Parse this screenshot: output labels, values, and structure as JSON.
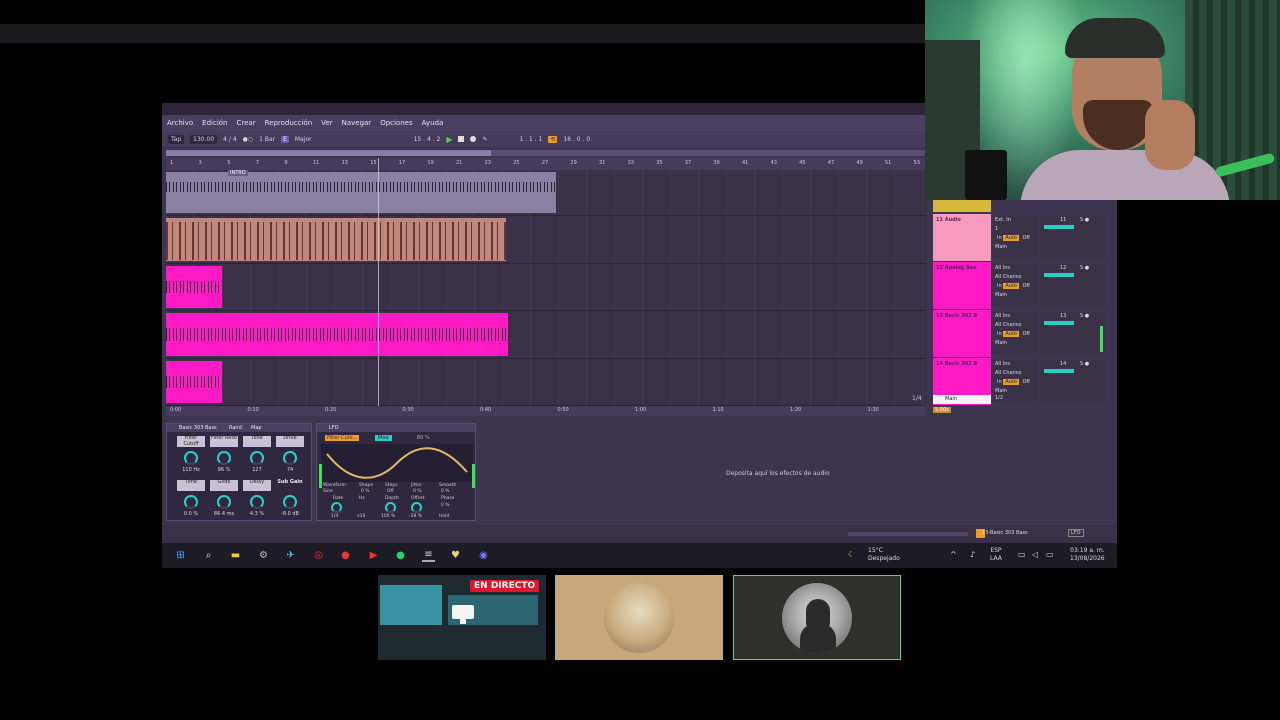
{
  "menu": [
    "Archivo",
    "Edición",
    "Crear",
    "Reproducción",
    "Ver",
    "Navegar",
    "Opciones",
    "Ayuda"
  ],
  "transport": {
    "tap": "Tap",
    "tempo": "130.00",
    "signature": "4 / 4",
    "quantize": "1 Bar",
    "key": "E",
    "scale": "Major",
    "position": "15 . 4 . 2",
    "loop_start": "1 . 1 . 1",
    "loop_length": "16 . 0 . 0"
  },
  "ruler": [
    "1",
    "3",
    "5",
    "7",
    "9",
    "11",
    "13",
    "15",
    "17",
    "19",
    "21",
    "23",
    "25",
    "27",
    "29",
    "31",
    "33",
    "35",
    "37",
    "39",
    "41",
    "43",
    "45",
    "47",
    "49",
    "51",
    "53"
  ],
  "locator": "INTRO",
  "timebar": [
    "0:00",
    "0:10",
    "0:20",
    "0:30",
    "0:40",
    "0:50",
    "1:00",
    "1:10",
    "1:20",
    "1:30"
  ],
  "tracks": [
    {
      "name": "11 Audio",
      "input": "Ext. In",
      "ch": "1",
      "monitor": [
        "In",
        "Auto",
        "Off"
      ],
      "out": "Main",
      "num": "11",
      "color": "#f79ac0"
    },
    {
      "name": "12 Analog Bas",
      "input": "All Ins",
      "ch": "All Channs",
      "monitor": [
        "In",
        "Auto",
        "Off"
      ],
      "out": "Main",
      "num": "12",
      "color": "#ff1ac6"
    },
    {
      "name": "13 Basic 303 B",
      "input": "All Ins",
      "ch": "All Channs",
      "monitor": [
        "In",
        "Auto",
        "Off"
      ],
      "out": "Main",
      "num": "13",
      "color": "#ff1ac6"
    },
    {
      "name": "14 Basic 303 B",
      "input": "All Ins",
      "ch": "All Channs",
      "monitor": [
        "In",
        "Auto",
        "Off"
      ],
      "out": "Main",
      "num": "14",
      "color": "#ff1ac6"
    }
  ],
  "main_row": {
    "label": "Main",
    "half": "1/2"
  },
  "fraction": "1/4",
  "tempo_chip": "5.00s",
  "rack": {
    "title": "Basic 303 Bass",
    "rand": "Rand",
    "map": "Map",
    "macros": [
      {
        "label": "Filter Cutoff",
        "value": "110 Hz"
      },
      {
        "label": "Filter Reso",
        "value": "96 %"
      },
      {
        "label": "Tone",
        "value": "127"
      },
      {
        "label": "Drive",
        "value": "74"
      },
      {
        "label": "Time",
        "value": "0.0 %"
      },
      {
        "label": "Glide",
        "value": "86.4 ms"
      },
      {
        "label": "Delay",
        "value": "4.3 %"
      },
      {
        "label": "Sub Gain",
        "value": "-8.0 dB"
      }
    ]
  },
  "lfo": {
    "title": "LFO",
    "map_target": "Filter Cuto...",
    "mapped": "Mod",
    "pct": "80 %",
    "labels": [
      "Waveform",
      "Shape",
      "Steps",
      "Jitter",
      "Smooth"
    ],
    "values": [
      "Sine",
      "0 %",
      "Off",
      "0 %",
      "0 %"
    ],
    "knobs": [
      "Rate",
      "Hz",
      "Depth",
      "Offset",
      "Phase"
    ],
    "knob_values": [
      "1/4",
      "x10",
      "100 %",
      "-28 %",
      "0 %"
    ],
    "hold": "Hold"
  },
  "drop_text": "Deposita aquí los efectos de audio",
  "status": {
    "track": "13-Basic 303 Bass",
    "lfo": "LFO"
  },
  "taskbar": {
    "temp": "15°C",
    "weather": "Despejado",
    "lang1": "ESP",
    "lang2": "LAA",
    "time": "03:19 a. m.",
    "date": "13/08/2026"
  },
  "live_badge": "EN DIRECTO"
}
